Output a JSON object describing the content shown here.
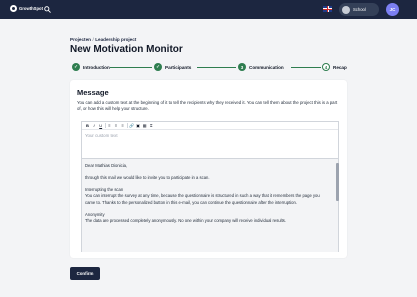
{
  "header": {
    "logo_text": "GrowthSpot",
    "school_label": "School",
    "avatar_initials": "JC"
  },
  "breadcrumb": {
    "items": [
      "Projecten",
      "Leadership project"
    ],
    "separator": "/"
  },
  "page_title": "New Motivation Monitor",
  "stepper": {
    "steps": [
      {
        "label": "Introduction",
        "state": "complete",
        "marker": "✓"
      },
      {
        "label": "Participants",
        "state": "complete",
        "marker": "✓"
      },
      {
        "label": "Communication",
        "state": "active",
        "marker": "3"
      },
      {
        "label": "Recap",
        "state": "upcoming",
        "marker": "4"
      }
    ]
  },
  "message": {
    "title": "Message",
    "intro": "You can add a custom text at the beginning of it to tell the recipients why they received it. You can tell them about the project this is a part of, or how this will help your structure.",
    "toolbar": {
      "bold": "B",
      "italic": "I",
      "underline": "U",
      "bullets": "≡",
      "numbered": "≡",
      "align": "≡",
      "link": "🔗",
      "image": "▣",
      "table": "▦",
      "code": "⌗"
    },
    "custom_placeholder": "Your custom text",
    "template": {
      "greeting": "Dear Mathias Dionicia,",
      "invite": "through this mail we would like to invite you to participate in a scan.",
      "interrupt_heading": "Interrupting the scan",
      "interrupt_body": "You can interrupt the survey at any time, because the questionnaire is structured in such a way that it remembers the page you came to. Thanks to the personalized button in this e-mail, you can continue the questionnaire after the interruption.",
      "anon_heading": "Anonymity",
      "anon_body": "The data are processed completely anonymously. No one within your company will receive individual results."
    }
  },
  "confirm_label": "Confirm",
  "colors": {
    "navbar": "#1c2640",
    "accent_green": "#2e7d4f",
    "avatar": "#7b7ff2",
    "page_bg": "#f3f4f6"
  }
}
